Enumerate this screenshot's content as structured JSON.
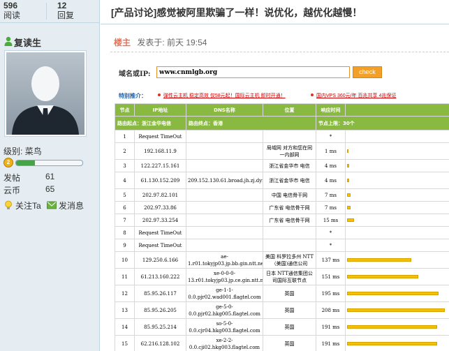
{
  "sidebar": {
    "views": "596",
    "views_label": "阅读",
    "replies": "12",
    "replies_label": "回复",
    "username": "复读生",
    "level_label": "级别:",
    "level": "菜鸟",
    "rank_icon_text": "2",
    "rank_progress": 0.28,
    "posts_label": "发帖",
    "posts": "61",
    "coins_label": "云币",
    "coins": "65",
    "follow_label": "关注Ta",
    "message_label": "发消息"
  },
  "post": {
    "title": "[产品讨论]感觉被阿里欺骗了一样！说优化，越优化越慢！",
    "floor": "楼主",
    "posted_prefix": "发表于:",
    "posted_time": "前天 19:54"
  },
  "lookup": {
    "domain_label": "域名或IP:",
    "domain_value": "www.cnmlgb.org",
    "check_label": "check",
    "promo_label": "特别推介：",
    "promo_links": [
      "弹性云主机 稳定高效 仅58元起！国际云主机 即时开通！",
      "国内VPS 360元/年 百兆共享 4兆保证"
    ]
  },
  "trace": {
    "summary": [
      "路由起点：浙江金华电信",
      "路由终点：香港",
      "节点上限：30个"
    ],
    "headers": [
      "节点",
      "IP地址",
      "DNS名称",
      "位置",
      "响应时间",
      ""
    ],
    "rows": [
      {
        "node": "1",
        "ip": "Request TimeOut",
        "dns": "",
        "loc": "",
        "time": "*",
        "ms": 0
      },
      {
        "node": "2",
        "ip": "192.168.11.9",
        "dns": "",
        "loc": "局域网 对方和您在同一内部网",
        "time": "1 ms",
        "ms": 1
      },
      {
        "node": "3",
        "ip": "122.227.15.161",
        "dns": "",
        "loc": "浙江省金华市 电信",
        "time": "4 ms",
        "ms": 4
      },
      {
        "node": "4",
        "ip": "61.130.152.209",
        "dns": "209.152.130.61.broad.jh.zj.dynamic.163data.com.cn",
        "loc": "浙江省金华市 电信",
        "time": "4 ms",
        "ms": 4
      },
      {
        "node": "5",
        "ip": "202.97.82.101",
        "dns": "",
        "loc": "中国 电信骨干网",
        "time": "7 ms",
        "ms": 7
      },
      {
        "node": "6",
        "ip": "202.97.33.86",
        "dns": "",
        "loc": "广东省 电信骨干网",
        "time": "7 ms",
        "ms": 7
      },
      {
        "node": "7",
        "ip": "202.97.33.254",
        "dns": "",
        "loc": "广东省 电信骨干网",
        "time": "15 ms",
        "ms": 15
      },
      {
        "node": "8",
        "ip": "Request TimeOut",
        "dns": "",
        "loc": "",
        "time": "*",
        "ms": 0
      },
      {
        "node": "9",
        "ip": "Request TimeOut",
        "dns": "",
        "loc": "",
        "time": "*",
        "ms": 0
      },
      {
        "node": "10",
        "ip": "129.250.6.166",
        "dns": "ae-1.r01.tokyjp03.jp.bb.gin.ntt.net",
        "loc": "美国 科罗拉多州 NTT（美国)通信公司",
        "time": "137 ms",
        "ms": 137
      },
      {
        "node": "11",
        "ip": "61.213.160.222",
        "dns": "xe-0-0-0-13.r01.tokyjp03.jp.ce.gin.ntt.net",
        "loc": "日本 NTT通信集团公司国际互联节点",
        "time": "151 ms",
        "ms": 151
      },
      {
        "node": "12",
        "ip": "85.95.26.117",
        "dns": "ge-1-1-0.0.pjr02.wad001.flagtel.com",
        "loc": "英国",
        "time": "195 ms",
        "ms": 195
      },
      {
        "node": "13",
        "ip": "85.95.26.205",
        "dns": "ge-5-0-0.0.pjr02.hkg005.flagtel.com",
        "loc": "英国",
        "time": "208 ms",
        "ms": 208
      },
      {
        "node": "14",
        "ip": "85.95.25.214",
        "dns": "so-5-0-0.0.cjr04.hkg003.flagtel.com",
        "loc": "英国",
        "time": "191 ms",
        "ms": 191
      },
      {
        "node": "15",
        "ip": "62.216.128.102",
        "dns": "xe-2-2-0.0.cji02.hkg003.flagtel.com",
        "loc": "英国",
        "time": "191 ms",
        "ms": 191
      }
    ]
  },
  "colors": {
    "header_green": "#8ab942",
    "bar_yellow": "#f5c000",
    "accent_orange": "#f3a02b",
    "sidebar_bg": "#e5edf2"
  }
}
